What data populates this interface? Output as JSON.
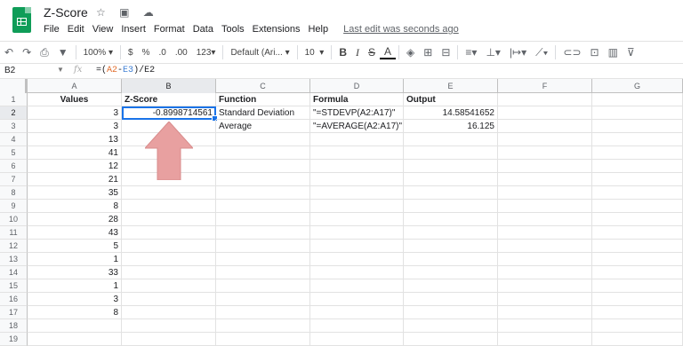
{
  "app": {
    "title": "Z-Score",
    "title_icons": "☆ ▣ ☁",
    "menu": [
      "File",
      "Edit",
      "View",
      "Insert",
      "Format",
      "Data",
      "Tools",
      "Extensions",
      "Help"
    ],
    "last_edit": "Last edit was seconds ago"
  },
  "toolbar": {
    "undo": "↶",
    "redo": "↷",
    "print": "⎙",
    "paint": "🖌",
    "zoom": "100%",
    "currency": "$",
    "percent": "%",
    "dec_less": ".0",
    "dec_more": ".00",
    "more_formats": "123",
    "font": "Default (Ari...",
    "font_size": "10",
    "bold": "B",
    "italic": "I",
    "strike": "S",
    "text_color": "A",
    "fill": "◈",
    "borders": "⊞",
    "merge": "⊟",
    "halign": "≡",
    "valign": "⊥",
    "wrap": "|↦",
    "rotate": "⟋",
    "link": "⊂⊃",
    "comment": "⊡",
    "chart": "▥",
    "filter": "⊽"
  },
  "formula_bar": {
    "cell_ref": "B2",
    "fx": "fx",
    "formula_prefix": "=(",
    "ref1": "A2",
    "formula_mid": "-",
    "ref2": "E3",
    "formula_suffix": ")/E2"
  },
  "columns": [
    "A",
    "B",
    "C",
    "D",
    "E",
    "F",
    "G"
  ],
  "rows": [
    {
      "n": "1",
      "A": "Values",
      "B": "Z-Score",
      "C": "Function",
      "D": "Formula",
      "E": "Output"
    },
    {
      "n": "2",
      "A": "3",
      "B": "-0.8998714561",
      "C": "Standard Deviation",
      "D": "\"=STDEVP(A2:A17)\"",
      "E": "14.58541652"
    },
    {
      "n": "3",
      "A": "3",
      "B": "",
      "C": "Average",
      "D": "\"=AVERAGE(A2:A17)\"",
      "E": "16.125"
    },
    {
      "n": "4",
      "A": "13"
    },
    {
      "n": "5",
      "A": "41"
    },
    {
      "n": "6",
      "A": "12"
    },
    {
      "n": "7",
      "A": "21"
    },
    {
      "n": "8",
      "A": "35"
    },
    {
      "n": "9",
      "A": "8"
    },
    {
      "n": "10",
      "A": "28"
    },
    {
      "n": "11",
      "A": "43"
    },
    {
      "n": "12",
      "A": "5"
    },
    {
      "n": "13",
      "A": "1"
    },
    {
      "n": "14",
      "A": "33"
    },
    {
      "n": "15",
      "A": "1"
    },
    {
      "n": "16",
      "A": "3"
    },
    {
      "n": "17",
      "A": "8"
    },
    {
      "n": "18"
    },
    {
      "n": "19"
    }
  ],
  "colors": {
    "sheets_green": "#0f9d58",
    "selection_blue": "#1a73e8",
    "arrow_fill": "#e8a0a0"
  }
}
